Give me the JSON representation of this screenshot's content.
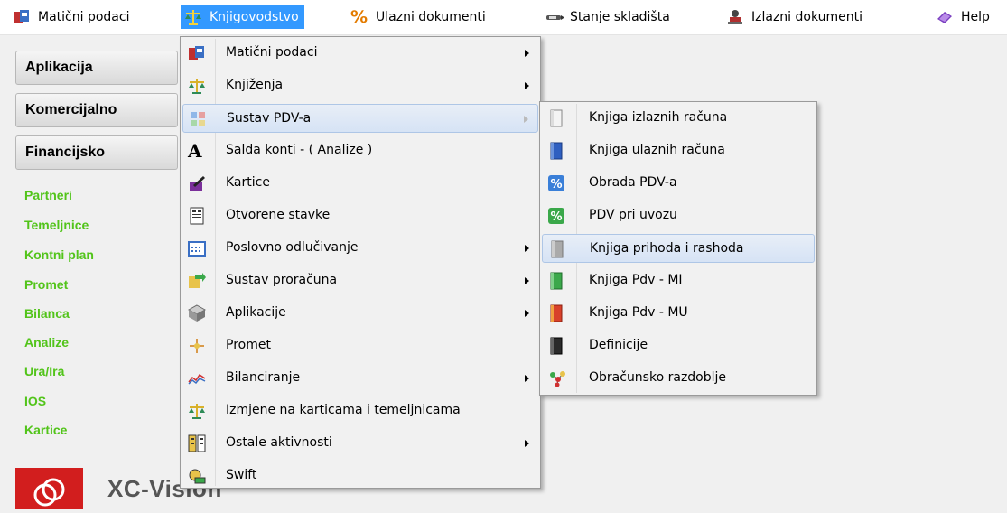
{
  "menubar": {
    "items": [
      {
        "label": "Matični podaci",
        "icon": "cards-icon"
      },
      {
        "label": "Knjigovodstvo",
        "icon": "scales-icon"
      },
      {
        "label": "Ulazni dokumenti",
        "icon": "percent-icon"
      },
      {
        "label": "Stanje skladišta",
        "icon": "pen-icon"
      },
      {
        "label": "Izlazni dokumenti",
        "icon": "stamp-icon"
      },
      {
        "label": "Help",
        "icon": "book-icon"
      }
    ]
  },
  "sidebar": {
    "sections": [
      "Aplikacija",
      "Komercijalno",
      "Financijsko"
    ],
    "links": [
      "Partneri",
      "Temeljnice",
      "Kontni plan",
      "Promet",
      "Bilanca",
      "Analize",
      "Ura/Ira",
      "IOS",
      "Kartice"
    ],
    "link_color": "#52c41a"
  },
  "logo": {
    "text": "XC-Vision"
  },
  "knjigovodstvo_menu": {
    "items": [
      {
        "label": "Matični podaci",
        "icon": "cards-icon",
        "submenu": true
      },
      {
        "label": "Knjiženja",
        "icon": "scales-icon",
        "submenu": true
      },
      {
        "label": "Sustav PDV-a",
        "icon": "grid-icon",
        "submenu": true
      },
      {
        "label": "Salda konti - ( Analize )",
        "icon": "letter-a-icon",
        "submenu": false
      },
      {
        "label": "Kartice",
        "icon": "pen-card-icon",
        "submenu": false
      },
      {
        "label": "Otvorene stavke",
        "icon": "document-icon",
        "submenu": false
      },
      {
        "label": "Poslovno odlučivanje",
        "icon": "calendar-icon",
        "submenu": true
      },
      {
        "label": "Sustav proračuna",
        "icon": "arrows-icon",
        "submenu": true
      },
      {
        "label": "Aplikacije",
        "icon": "box-icon",
        "submenu": true
      },
      {
        "label": "Promet",
        "icon": "flow-icon",
        "submenu": false
      },
      {
        "label": "Bilanciranje",
        "icon": "chart-icon",
        "submenu": true
      },
      {
        "label": "Izmjene na karticama i temeljnicama",
        "icon": "scales-icon",
        "submenu": false
      },
      {
        "label": "Ostale aktivnosti",
        "icon": "list-icon",
        "submenu": true
      },
      {
        "label": "Swift",
        "icon": "swift-icon",
        "submenu": false
      }
    ]
  },
  "pdv_submenu": {
    "items": [
      {
        "label": "Knjiga izlaznih računa",
        "icon": "book-white-icon"
      },
      {
        "label": "Knjiga ulaznih računa",
        "icon": "book-blue-icon"
      },
      {
        "label": "Obrada PDV-a",
        "icon": "percent-blue-icon"
      },
      {
        "label": "PDV pri uvozu",
        "icon": "percent-green-icon"
      },
      {
        "label": "Knjiga prihoda i rashoda",
        "icon": "book-grey-icon"
      },
      {
        "label": "Knjiga Pdv - MI",
        "icon": "book-green-icon"
      },
      {
        "label": "Knjiga Pdv - MU",
        "icon": "book-red-icon"
      },
      {
        "label": "Definicije",
        "icon": "book-black-icon"
      },
      {
        "label": "Obračunsko razdoblje",
        "icon": "molecule-icon"
      }
    ]
  },
  "colors": {
    "menubar_active": "#3399ff",
    "submenu_highlight": "#d6e3f5",
    "logo_red": "#d21e1e"
  }
}
